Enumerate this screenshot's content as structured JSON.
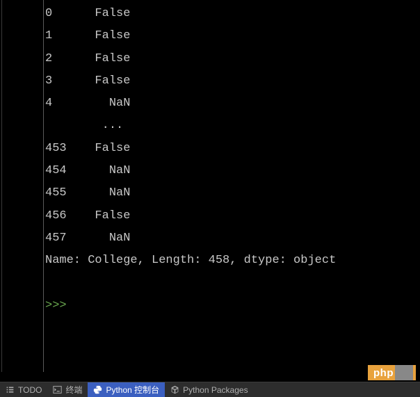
{
  "console": {
    "rows": [
      {
        "index": "0",
        "value": "False"
      },
      {
        "index": "1",
        "value": "False"
      },
      {
        "index": "2",
        "value": "False"
      },
      {
        "index": "3",
        "value": "False"
      },
      {
        "index": "4",
        "value": "  NaN"
      },
      {
        "index": "",
        "value": " ...  "
      },
      {
        "index": "453",
        "value": "False"
      },
      {
        "index": "454",
        "value": "  NaN"
      },
      {
        "index": "455",
        "value": "  NaN"
      },
      {
        "index": "456",
        "value": "False"
      },
      {
        "index": "457",
        "value": "  NaN"
      }
    ],
    "summary": "Name: College, Length: 458, dtype: object",
    "prompt": ">>> "
  },
  "bottom_bar": {
    "todo": "TODO",
    "terminal": "终端",
    "python_console": "Python 控制台",
    "python_packages": "Python Packages"
  },
  "watermark": {
    "text": "php"
  }
}
